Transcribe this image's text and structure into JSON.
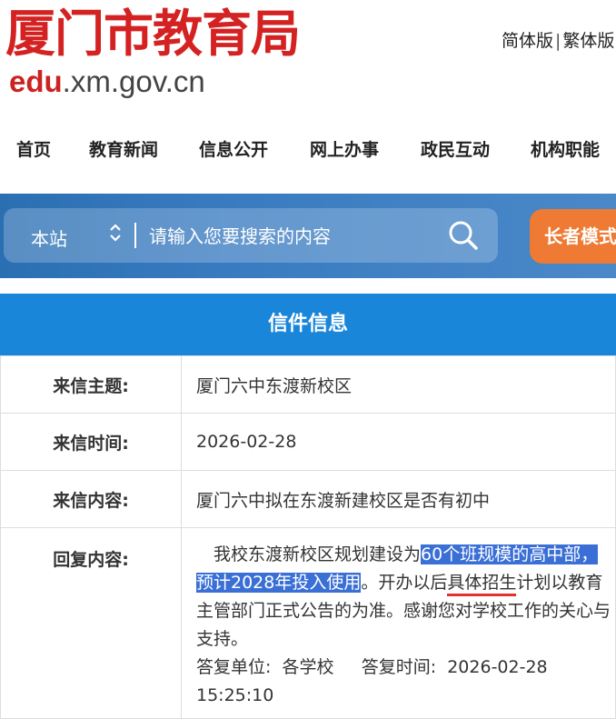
{
  "header": {
    "logo_text": "厦门市教育局",
    "domain_red": "edu",
    "domain_rest": ".xm.gov.cn",
    "lang_simplified": "简体版",
    "lang_separator": "|",
    "lang_traditional": "繁体版"
  },
  "nav": {
    "items": [
      "首页",
      "教育新闻",
      "信息公开",
      "网上办事",
      "政民互动",
      "机构职能"
    ]
  },
  "search": {
    "scope": "本站",
    "placeholder": "请输入您要搜索的内容",
    "elder_mode": "长者模式"
  },
  "letter": {
    "section_title": "信件信息",
    "rows": [
      {
        "label": "来信主题:",
        "value": "厦门六中东渡新校区"
      },
      {
        "label": "来信时间:",
        "value": "2026-02-28"
      },
      {
        "label": "来信内容:",
        "value": "厦门六中拟在东渡新建校区是否有初中"
      }
    ],
    "reply_label": "回复内容:",
    "reply": {
      "part1": "我校东渡新校区规划建设为",
      "highlight": "60个班规模的高中部，预计2028年投入使用",
      "part2": "。开办以后",
      "underline": "具体招生",
      "part3": "计划以教育主管部门正式公告的为准。感谢您对学校工作的关心与支持。"
    },
    "reply_unit_label": "答复单位:",
    "reply_unit": "各学校",
    "reply_time_label": "答复时间:",
    "reply_time": "2026-02-28 15:25:10"
  },
  "colors": {
    "logo_red": "#d42222",
    "search_blue": "#2b6fb3",
    "header_blue": "#1a86d9",
    "elder_orange": "#ee7a33",
    "highlight_blue": "#3a6fd6",
    "underline_red": "#e03030"
  }
}
